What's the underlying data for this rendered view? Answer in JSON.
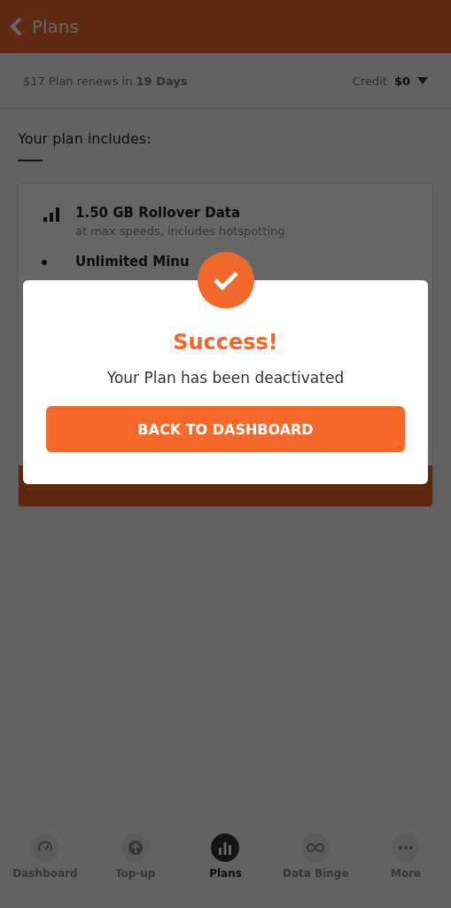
{
  "header": {
    "title": "Plans"
  },
  "plan_bar": {
    "renewal": "$17 Plan renews in **19 Days**",
    "credit_label": "Credit",
    "credit_value": "$0"
  },
  "section_title": "Your plan includes:",
  "features": [
    {
      "kind": "data",
      "title": "1.50 GB Rollover Data",
      "subtitle": "at max speeds, includes hotspotting"
    },
    {
      "kind": "minutes",
      "title": "Unlimited Minu"
    }
  ],
  "dialog": {
    "title": "Success!",
    "message": "Your Plan has been deactivated",
    "button": "BACK TO DASHBOARD"
  },
  "tabs": [
    {
      "kind": "gauge",
      "label": "Dashboard",
      "selected": false
    },
    {
      "kind": "topup",
      "label": "Top-up",
      "selected": false
    },
    {
      "kind": "plans",
      "label": "Plans",
      "selected": true
    },
    {
      "kind": "infinity",
      "label": "Data Binge",
      "selected": false
    },
    {
      "kind": "more",
      "label": "More",
      "selected": false
    }
  ]
}
